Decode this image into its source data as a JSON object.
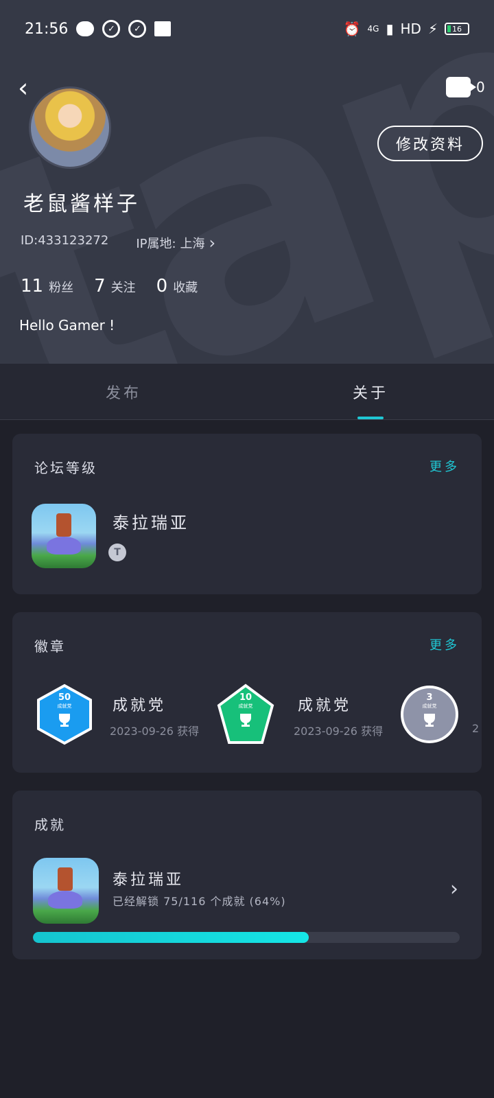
{
  "status_bar": {
    "time": "21:56",
    "network": "4G",
    "hd": "HD",
    "battery": "16"
  },
  "header": {
    "camera_count": "0",
    "edit_profile": "修改资料",
    "username": "老鼠酱样子",
    "id": "ID:433123272",
    "ip_label": "IP属地:",
    "ip_value": "上海",
    "ip_arrow": "›",
    "stats": [
      {
        "num": "11",
        "label": "粉丝"
      },
      {
        "num": "7",
        "label": "关注"
      },
      {
        "num": "0",
        "label": "收藏"
      }
    ],
    "bio": "Hello Gamer !"
  },
  "tabs": [
    {
      "label": "发布",
      "active": false
    },
    {
      "label": "关于",
      "active": true
    }
  ],
  "forum_level": {
    "title": "论坛等级",
    "more": "更多",
    "game_name": "泰拉瑞亚",
    "badge_letter": "T"
  },
  "badges": {
    "title": "徽章",
    "more": "更多",
    "items": [
      {
        "num": "50",
        "sub": "成就党",
        "title": "成就党",
        "date": "2023-09-26 获得",
        "color": "#1a9cf0"
      },
      {
        "num": "10",
        "sub": "成就党",
        "title": "成就党",
        "date": "2023-09-26 获得",
        "color": "#17c07a"
      },
      {
        "num": "3",
        "sub": "成就党",
        "title": "",
        "date": "2",
        "color": "#8e93a8"
      }
    ]
  },
  "achievements": {
    "title": "成就",
    "game_name": "泰拉瑞亚",
    "progress_text": "已经解锁 75/116 个成就 (64%)",
    "progress_fraction": 0.647,
    "arrow": "›"
  },
  "colors": {
    "accent": "#1fc7d4",
    "header_bg": "#353946",
    "page_bg": "#1f2029",
    "card_bg": "#292b37"
  }
}
